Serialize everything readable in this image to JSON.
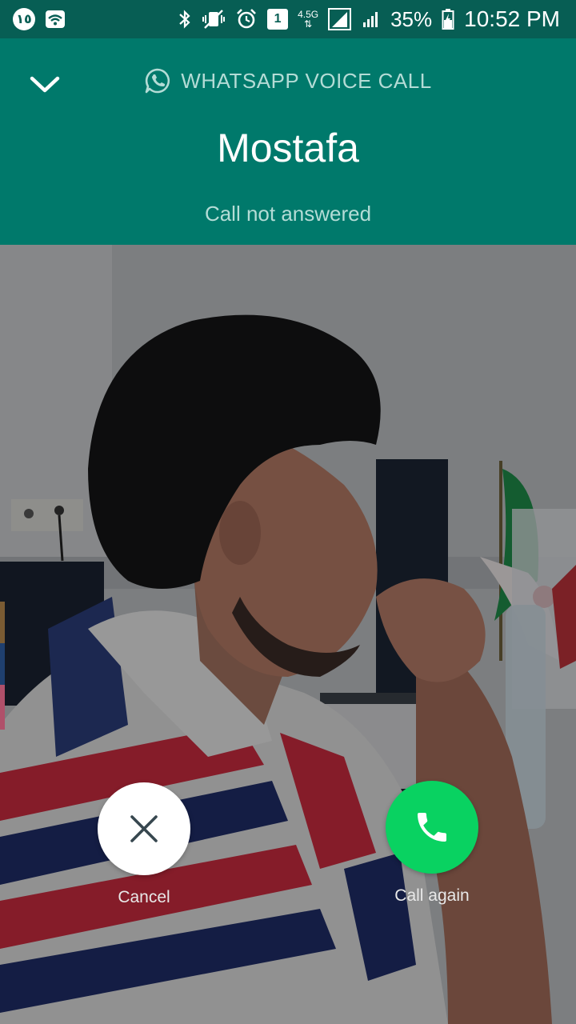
{
  "status_bar": {
    "notification_count": "١٥",
    "network_type": "4.5G",
    "sim_slot": "1",
    "battery_percent": "35%",
    "time": "10:52 PM"
  },
  "call": {
    "type_label": "WHATSAPP VOICE CALL",
    "contact_name": "Mostafa",
    "status": "Call not answered"
  },
  "actions": {
    "cancel_label": "Cancel",
    "call_again_label": "Call again"
  },
  "colors": {
    "header_bg": "#00796b",
    "statusbar_bg": "#075e54",
    "call_again_green": "#09d261",
    "muted_text": "#b4dcd6"
  },
  "icons": [
    "wifi-icon",
    "bluetooth-icon",
    "vibrate-icon",
    "alarm-icon",
    "signal-icon",
    "battery-icon",
    "chevron-down-icon",
    "whatsapp-icon",
    "close-icon",
    "phone-icon"
  ]
}
